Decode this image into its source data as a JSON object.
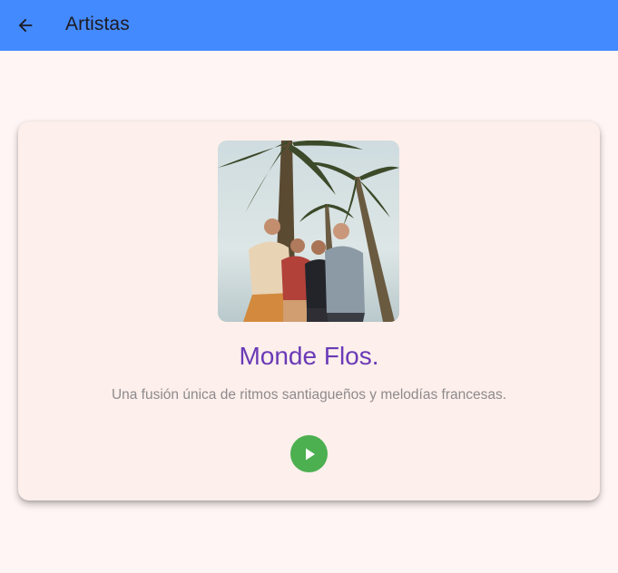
{
  "app_bar": {
    "title": "Artistas",
    "back_icon": "arrow-back-icon",
    "background_color": "#448aff"
  },
  "artist_card": {
    "name": "Monde Flos.",
    "description": "Una fusión única de ritmos santiagueños y melodías francesas.",
    "name_color": "#6a3ab7",
    "image_subject": "band-photo",
    "play_icon": "play-icon",
    "play_button_color": "#4caf50"
  }
}
